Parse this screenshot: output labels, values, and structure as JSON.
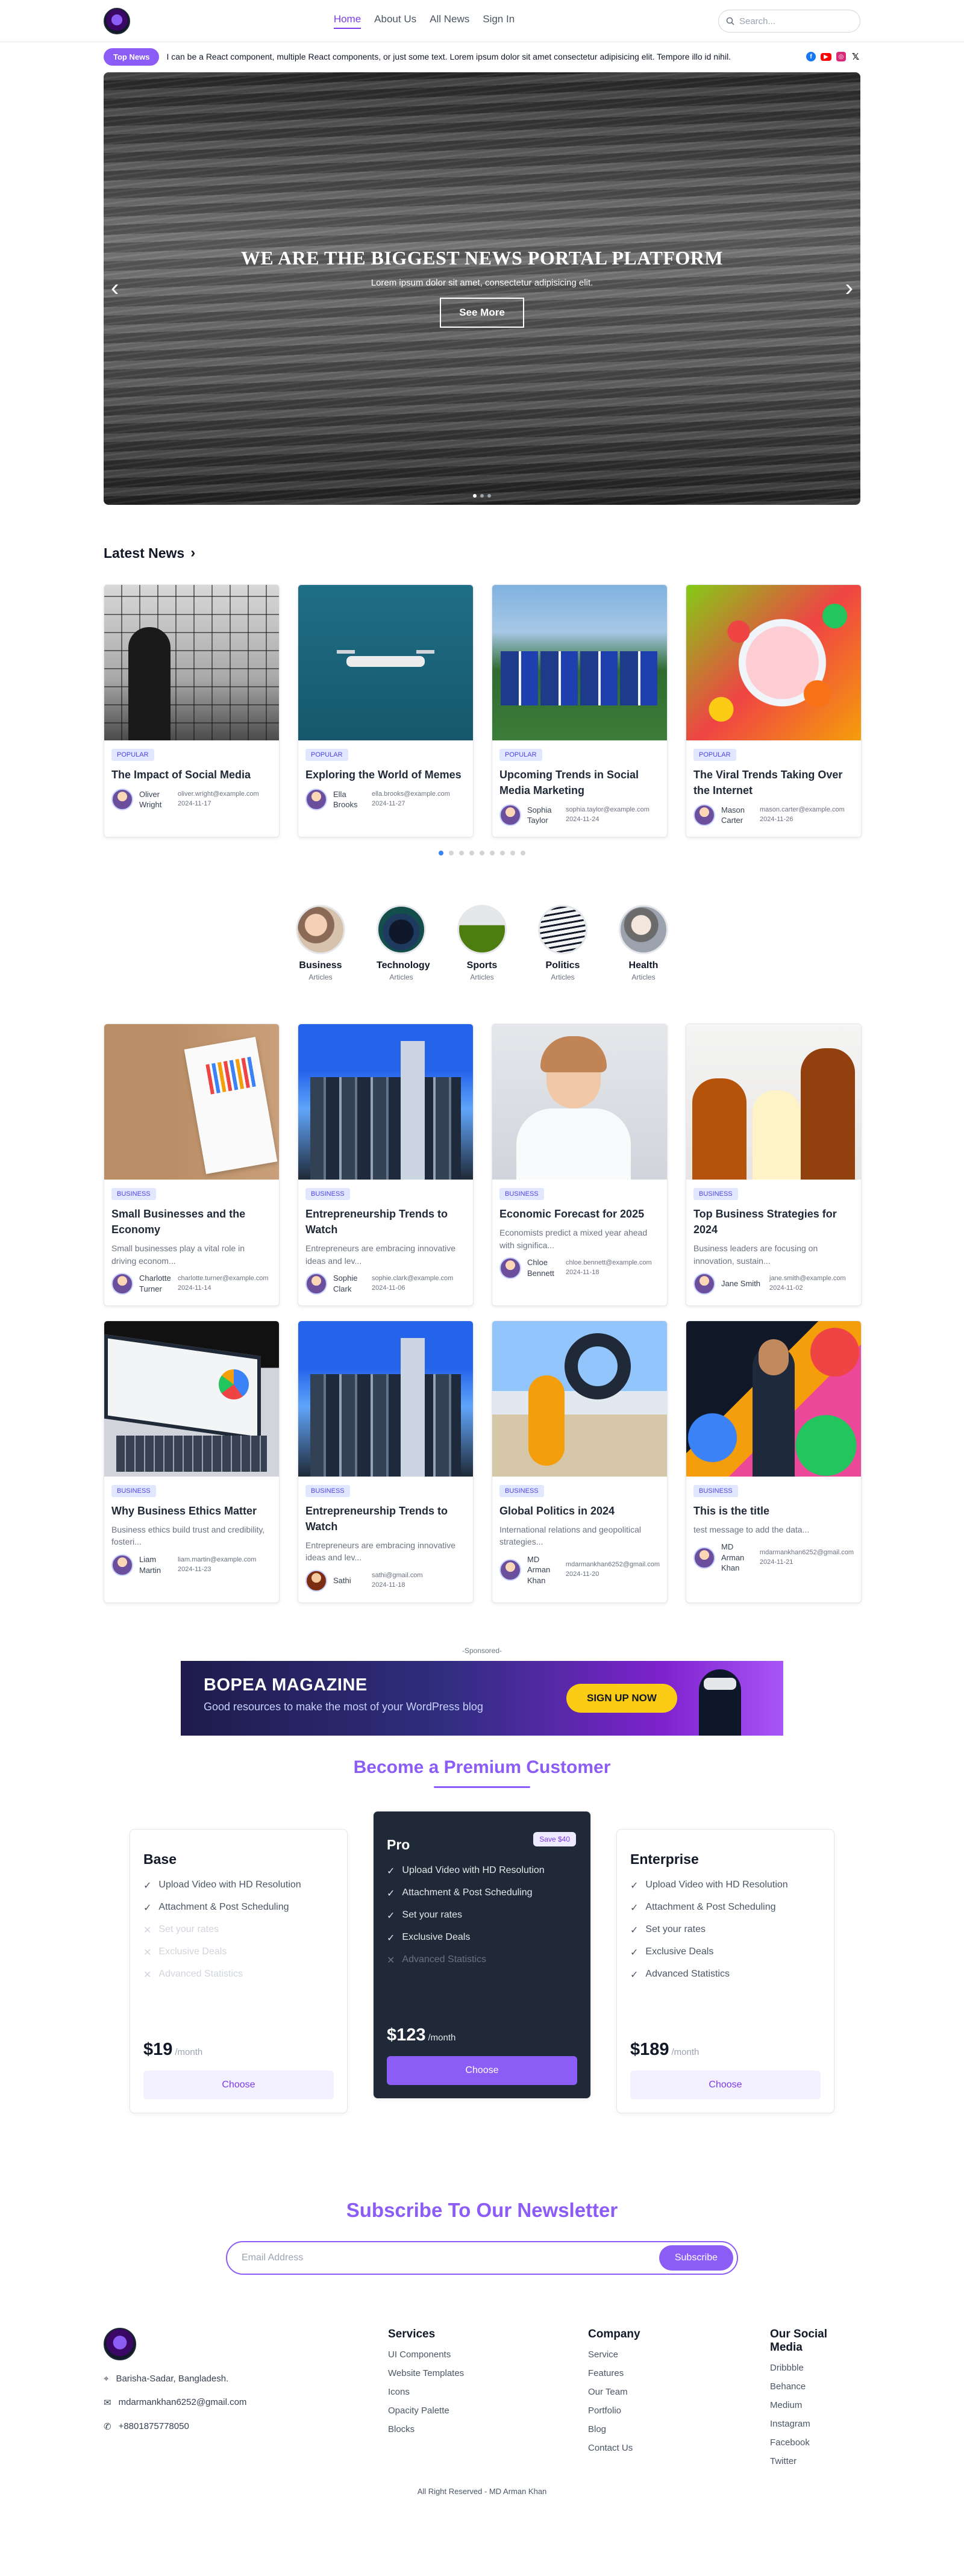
{
  "nav": {
    "links": [
      "Home",
      "About Us",
      "All News",
      "Sign In"
    ],
    "search_placeholder": "Search..."
  },
  "topnews": {
    "label": "Top News",
    "text": "I can be a React component, multiple React components, or just some text. Lorem ipsum dolor sit amet consectetur adipisicing elit. Tempore illo id nihil."
  },
  "hero": {
    "title": "WE ARE THE BIGGEST NEWS PORTAL PLATFORM",
    "subtitle": "Lorem ipsum dolor sit amet, consectetur adipisicing elit.",
    "button": "See More",
    "prev_icon": "chevron-left-icon",
    "next_icon": "chevron-right-icon"
  },
  "latest": {
    "title": "Latest News",
    "cards": [
      {
        "tag": "POPULAR",
        "title": "The Impact of Social Media",
        "author": "Oliver Wright",
        "email": "oliver.wright@example.com",
        "date": "2024-11-17"
      },
      {
        "tag": "POPULAR",
        "title": "Exploring the World of Memes",
        "author": "Ella Brooks",
        "email": "ella.brooks@example.com",
        "date": "2024-11-27"
      },
      {
        "tag": "POPULAR",
        "title": "Upcoming Trends in Social Media Marketing",
        "author": "Sophia Taylor",
        "email": "sophia.taylor@example.com",
        "date": "2024-11-24"
      },
      {
        "tag": "POPULAR",
        "title": "The Viral Trends Taking Over the Internet",
        "author": "Mason Carter",
        "email": "mason.carter@example.com",
        "date": "2024-11-26"
      }
    ]
  },
  "categories": [
    {
      "name": "Business",
      "sub": "Articles"
    },
    {
      "name": "Technology",
      "sub": "Articles"
    },
    {
      "name": "Sports",
      "sub": "Articles"
    },
    {
      "name": "Politics",
      "sub": "Articles"
    },
    {
      "name": "Health",
      "sub": "Articles"
    }
  ],
  "business": [
    {
      "tag": "BUSINESS",
      "title": "Small Businesses and the Economy",
      "desc": "Small businesses play a vital role in driving econom...",
      "author": "Charlotte Turner",
      "email": "charlotte.turner@example.com",
      "date": "2024-11-14"
    },
    {
      "tag": "BUSINESS",
      "title": "Entrepreneurship Trends to Watch",
      "desc": "Entrepreneurs are embracing innovative ideas and lev...",
      "author": "Sophie Clark",
      "email": "sophie.clark@example.com",
      "date": "2024-11-06"
    },
    {
      "tag": "BUSINESS",
      "title": "Economic Forecast for 2025",
      "desc": "Economists predict a mixed year ahead with significa...",
      "author": "Chloe Bennett",
      "email": "chloe.bennett@example.com",
      "date": "2024-11-18"
    },
    {
      "tag": "BUSINESS",
      "title": "Top Business Strategies for 2024",
      "desc": "Business leaders are focusing on innovation, sustain...",
      "author": "Jane Smith",
      "email": "jane.smith@example.com",
      "date": "2024-11-02"
    },
    {
      "tag": "BUSINESS",
      "title": "Why Business Ethics Matter",
      "desc": "Business ethics build trust and credibility, fosteri...",
      "author": "Liam Martin",
      "email": "liam.martin@example.com",
      "date": "2024-11-23"
    },
    {
      "tag": "BUSINESS",
      "title": "Entrepreneurship Trends to Watch",
      "desc": "Entrepreneurs are embracing innovative ideas and lev...",
      "author": "Sathi",
      "email": "sathi@gmail.com",
      "date": "2024-11-18"
    },
    {
      "tag": "BUSINESS",
      "title": "Global Politics in 2024",
      "desc": "International relations and geopolitical strategies...",
      "author": "MD Arman Khan",
      "email": "mdarmankhan6252@gmail.com",
      "date": "2024-11-20"
    },
    {
      "tag": "BUSINESS",
      "title": "This is the title",
      "desc": "test message to add the data...",
      "author": "MD Arman Khan",
      "email": "mdarmankhan6252@gmail.com",
      "date": "2024-11-21"
    }
  ],
  "sponsor": {
    "label": "-Sponsored-",
    "title": "BOPEA MAGAZINE",
    "subtitle": "Good resources to make the most of your WordPress blog",
    "button": "SIGN UP NOW"
  },
  "pricing": {
    "title": "Become a Premium Customer",
    "plans": [
      {
        "name": "Base",
        "price": "$19",
        "per": "/month",
        "button": "Choose",
        "features": [
          {
            "text": "Upload Video with HD Resolution",
            "on": true
          },
          {
            "text": "Attachment & Post Scheduling",
            "on": true
          },
          {
            "text": "Set your rates",
            "on": false
          },
          {
            "text": "Exclusive Deals",
            "on": false
          },
          {
            "text": "Advanced Statistics",
            "on": false
          }
        ]
      },
      {
        "name": "Pro",
        "badge": "Save $40",
        "price": "$123",
        "per": "/month",
        "button": "Choose",
        "features": [
          {
            "text": "Upload Video with HD Resolution",
            "on": true
          },
          {
            "text": "Attachment & Post Scheduling",
            "on": true
          },
          {
            "text": "Set your rates",
            "on": true
          },
          {
            "text": "Exclusive Deals",
            "on": true
          },
          {
            "text": "Advanced Statistics",
            "on": false
          }
        ]
      },
      {
        "name": "Enterprise",
        "price": "$189",
        "per": "/month",
        "button": "Choose",
        "features": [
          {
            "text": "Upload Video with HD Resolution",
            "on": true
          },
          {
            "text": "Attachment & Post Scheduling",
            "on": true
          },
          {
            "text": "Set your rates",
            "on": true
          },
          {
            "text": "Exclusive Deals",
            "on": true
          },
          {
            "text": "Advanced Statistics",
            "on": true
          }
        ]
      }
    ]
  },
  "newsletter": {
    "title": "Subscribe To Our Newsletter",
    "placeholder": "Email Address",
    "button": "Subscribe"
  },
  "footer": {
    "address": "Barisha-Sadar, Bangladesh.",
    "email": "mdarmankhan6252@gmail.com",
    "phone": "+8801875778050",
    "services": {
      "title": "Services",
      "items": [
        "UI Components",
        "Website Templates",
        "Icons",
        "Opacity Palette",
        "Blocks"
      ]
    },
    "company": {
      "title": "Company",
      "items": [
        "Service",
        "Features",
        "Our Team",
        "Portfolio",
        "Blog",
        "Contact Us"
      ]
    },
    "social": {
      "title": "Our Social Media",
      "items": [
        "Dribbble",
        "Behance",
        "Medium",
        "Instagram",
        "Facebook",
        "Twitter"
      ]
    },
    "copyright": "All Right Reserved - MD Arman Khan"
  },
  "colors": {
    "accent": "#8b5cf6",
    "dark": "#1f2937",
    "tag_bg": "#e0e7ff",
    "tag_text": "#4f46e5"
  }
}
